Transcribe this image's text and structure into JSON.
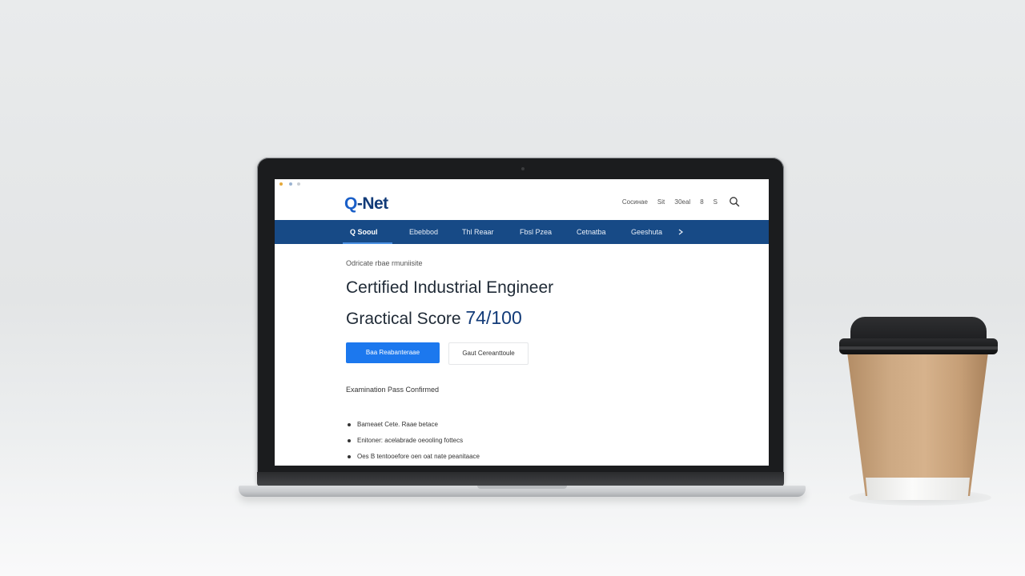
{
  "site": {
    "logo_q": "Q",
    "logo_rest": "-Net",
    "top_links": [
      "Cосинае",
      "Sit",
      "З0еаl",
      "8",
      "S"
    ]
  },
  "nav": {
    "items": [
      {
        "label": "Q Sooul",
        "active": true
      },
      {
        "label": "Ebebbod",
        "active": false
      },
      {
        "label": "Thl Reaar",
        "active": false
      },
      {
        "label": "Fbsl Pzea",
        "active": false
      },
      {
        "label": "Cetnatba",
        "active": false
      },
      {
        "label": "Geeshuta",
        "active": false
      }
    ]
  },
  "main": {
    "breadcrumb": "Odricate rbae rmuniisite",
    "title_line1": "Certified Industrial Engineer",
    "title_line2_prefix": "Gractical Score ",
    "score": "74/100",
    "primary_button": "Baa Reabanteraae",
    "secondary_button": "Gaut Cereanttoule",
    "status": "Examination Pass Confirmed",
    "bullets": [
      "Bameaet Cete. Raae betace",
      "Enitoner: acelabrade oeooling fottecs",
      "Oes B tentooefore oen oat nate peanitaace"
    ]
  },
  "colors": {
    "nav_bg": "#174a86",
    "primary": "#1c78ee",
    "logo": "#123b78"
  }
}
